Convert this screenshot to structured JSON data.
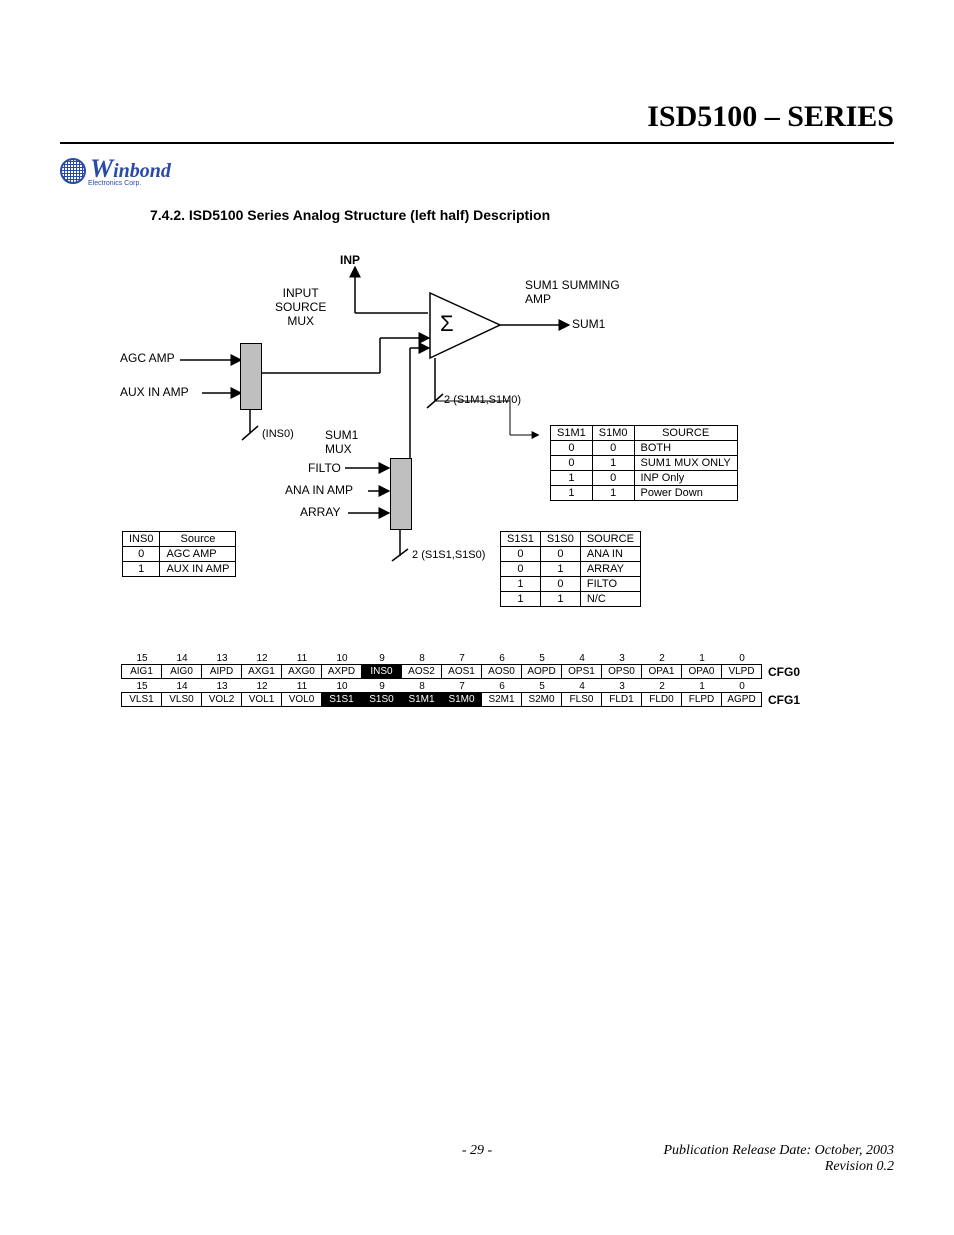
{
  "header": {
    "title": "ISD5100 – SERIES",
    "brand": "inbond",
    "brand_sub": "Electronics Corp."
  },
  "section": {
    "number": "7.4.2.",
    "title": "ISD5100 Series Analog Structure (left half) Description"
  },
  "diagram": {
    "inp": "INP",
    "input_source_mux_l1": "INPUT",
    "input_source_mux_l2": "SOURCE",
    "input_source_mux_l3": "MUX",
    "agc_amp": "AGC AMP",
    "aux_in_amp": "AUX IN AMP",
    "sum1_summing": "SUM1 SUMMING",
    "amp": "AMP",
    "sigma": "Σ",
    "sum1": "SUM1",
    "mux_ctrl1_l1": "2",
    "mux_ctrl1_l2": "(S1M1,S1M0)",
    "sum1_mux_l1": "SUM1",
    "sum1_mux_l2": "MUX",
    "filto": "FILTO",
    "ana_in_amp": "ANA IN AMP",
    "array": "ARRAY",
    "inso": "(INS0)",
    "mux_ctrl2_l1": "2",
    "mux_ctrl2_l2": "(S1S1,S1S0)"
  },
  "truth_ins0": {
    "headers": [
      "INS0",
      "Source"
    ],
    "rows": [
      [
        "0",
        "AGC AMP"
      ],
      [
        "1",
        "AUX IN AMP"
      ]
    ]
  },
  "truth_s1m": {
    "headers": [
      "S1M1",
      "S1M0",
      "SOURCE"
    ],
    "rows": [
      [
        "0",
        "0",
        "BOTH"
      ],
      [
        "0",
        "1",
        "SUM1 MUX ONLY"
      ],
      [
        "1",
        "0",
        "INP Only"
      ],
      [
        "1",
        "1",
        "Power Down"
      ]
    ]
  },
  "truth_s1s": {
    "headers": [
      "S1S1",
      "S1S0",
      "SOURCE"
    ],
    "rows": [
      [
        "0",
        "0",
        "ANA IN"
      ],
      [
        "0",
        "1",
        "ARRAY"
      ],
      [
        "1",
        "0",
        "FILTO"
      ],
      [
        "1",
        "1",
        "N/C"
      ]
    ]
  },
  "registers": {
    "bitnums": [
      "15",
      "14",
      "13",
      "12",
      "11",
      "10",
      "9",
      "8",
      "7",
      "6",
      "5",
      "4",
      "3",
      "2",
      "1",
      "0"
    ],
    "cfg0": {
      "label": "CFG0",
      "cells": [
        {
          "t": "AIG1",
          "hl": false
        },
        {
          "t": "AIG0",
          "hl": false
        },
        {
          "t": "AIPD",
          "hl": false
        },
        {
          "t": "AXG1",
          "hl": false
        },
        {
          "t": "AXG0",
          "hl": false
        },
        {
          "t": "AXPD",
          "hl": false
        },
        {
          "t": "INS0",
          "hl": true
        },
        {
          "t": "AOS2",
          "hl": false
        },
        {
          "t": "AOS1",
          "hl": false
        },
        {
          "t": "AOS0",
          "hl": false
        },
        {
          "t": "AOPD",
          "hl": false
        },
        {
          "t": "OPS1",
          "hl": false
        },
        {
          "t": "OPS0",
          "hl": false
        },
        {
          "t": "OPA1",
          "hl": false
        },
        {
          "t": "OPA0",
          "hl": false
        },
        {
          "t": "VLPD",
          "hl": false
        }
      ]
    },
    "cfg1": {
      "label": "CFG1",
      "cells": [
        {
          "t": "VLS1",
          "hl": false
        },
        {
          "t": "VLS0",
          "hl": false
        },
        {
          "t": "VOL2",
          "hl": false
        },
        {
          "t": "VOL1",
          "hl": false
        },
        {
          "t": "VOL0",
          "hl": false
        },
        {
          "t": "S1S1",
          "hl": true
        },
        {
          "t": "S1S0",
          "hl": true
        },
        {
          "t": "S1M1",
          "hl": true
        },
        {
          "t": "S1M0",
          "hl": true
        },
        {
          "t": "S2M1",
          "hl": false
        },
        {
          "t": "S2M0",
          "hl": false
        },
        {
          "t": "FLS0",
          "hl": false
        },
        {
          "t": "FLD1",
          "hl": false
        },
        {
          "t": "FLD0",
          "hl": false
        },
        {
          "t": "FLPD",
          "hl": false
        },
        {
          "t": "AGPD",
          "hl": false
        }
      ]
    }
  },
  "footer": {
    "page": "- 29 -",
    "pub": "Publication Release Date: October, 2003",
    "rev": "Revision 0.2"
  }
}
